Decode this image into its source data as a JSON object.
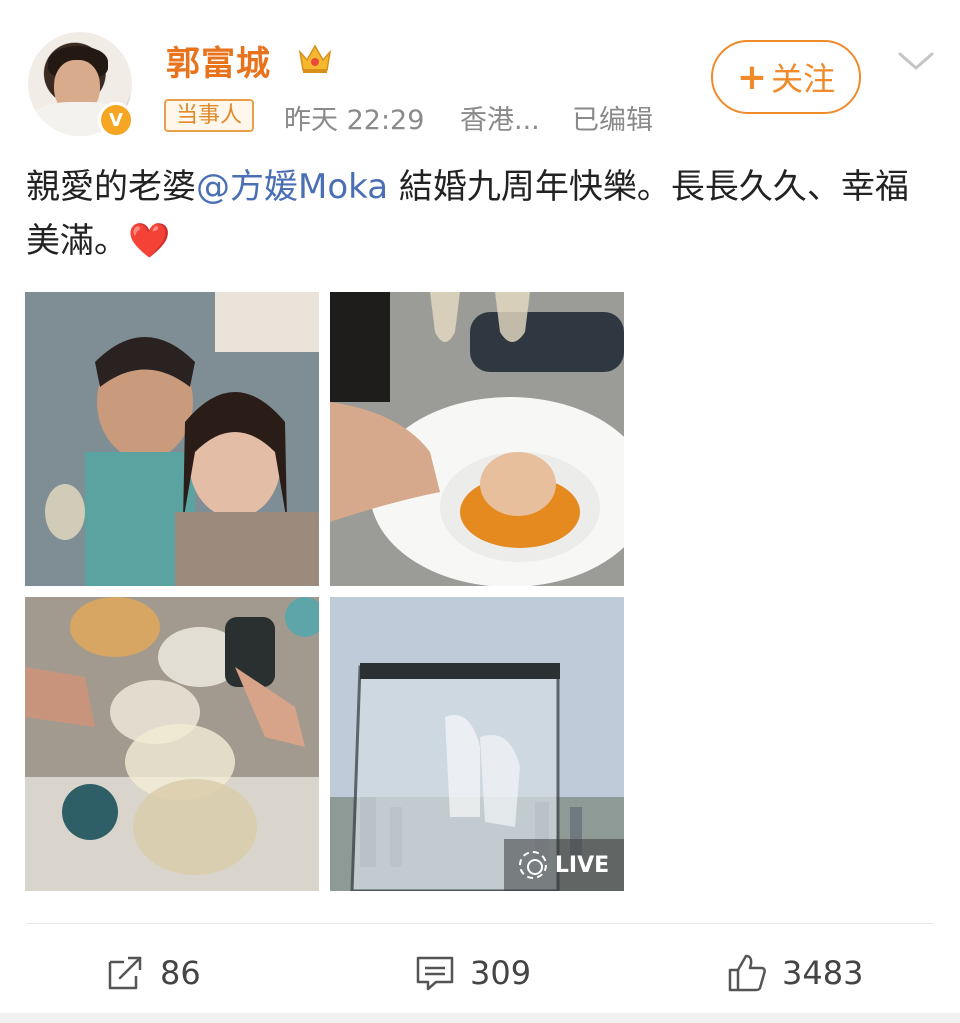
{
  "post": {
    "author": {
      "name": "郭富城",
      "badge_icon": "crown-icon",
      "verified_icon": "verified-v-icon"
    },
    "tag": "当事人",
    "time": "昨天 22:29",
    "location": "香港...",
    "edited": "已编辑",
    "follow_label": "关注",
    "text_before_mention": "親愛的老婆",
    "mention": "@方媛Moka",
    "text_after_mention": " 結婚九周年快樂。長長久久、幸福美滿。",
    "emoji": "❤️",
    "photos": [
      {
        "alt": "selfie-couple-photo"
      },
      {
        "alt": "dessert-plate-photo"
      },
      {
        "alt": "toast-glasses-photo"
      },
      {
        "alt": "glass-award-photo",
        "live_label": "LIVE"
      }
    ]
  },
  "actions": {
    "share_count": "86",
    "comment_count": "309",
    "like_count": "3483"
  },
  "colors": {
    "accent": "#f08a2a",
    "username": "#e8731c",
    "mention": "#4a6fb5",
    "meta": "#8a8a8a"
  }
}
